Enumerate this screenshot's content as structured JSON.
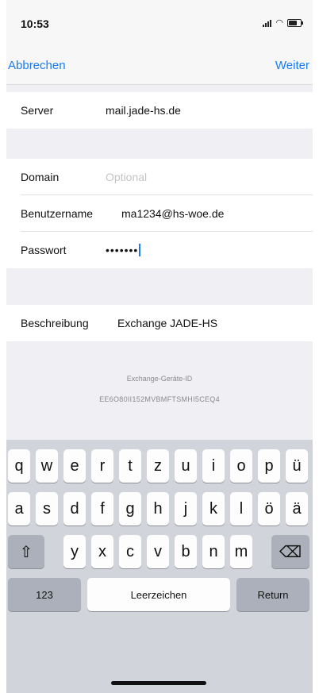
{
  "status_bar": {
    "time": "10:53"
  },
  "nav": {
    "cancel_label": "Abbrechen",
    "next_label": "Weiter"
  },
  "form": {
    "server": {
      "label": "Server",
      "value": "mail.jade-hs.de"
    },
    "domain": {
      "label": "Domain",
      "placeholder": "Optional"
    },
    "username": {
      "label": "Benutzername",
      "value": "ma1234@hs-woe.de"
    },
    "password": {
      "label": "Passwort",
      "value": "•••••••"
    },
    "description": {
      "label": "Beschreibung",
      "value": "Exchange JADE-HS"
    }
  },
  "device_id": {
    "label": "Exchange-Geräte-ID",
    "value": "EE6O80II152MVBMFTSMHI5CEQ4"
  },
  "keyboard": {
    "row1": [
      "q",
      "w",
      "e",
      "r",
      "t",
      "z",
      "u",
      "i",
      "o",
      "p",
      "ü"
    ],
    "row2": [
      "a",
      "s",
      "d",
      "f",
      "g",
      "h",
      "j",
      "k",
      "l",
      "ö",
      "ä"
    ],
    "row3": [
      "y",
      "x",
      "c",
      "v",
      "b",
      "n",
      "m"
    ],
    "numbers_label": "123",
    "space_label": "Leerzeichen",
    "return_label": "Return",
    "shift_symbol": "⇧",
    "delete_symbol": "⌫"
  }
}
